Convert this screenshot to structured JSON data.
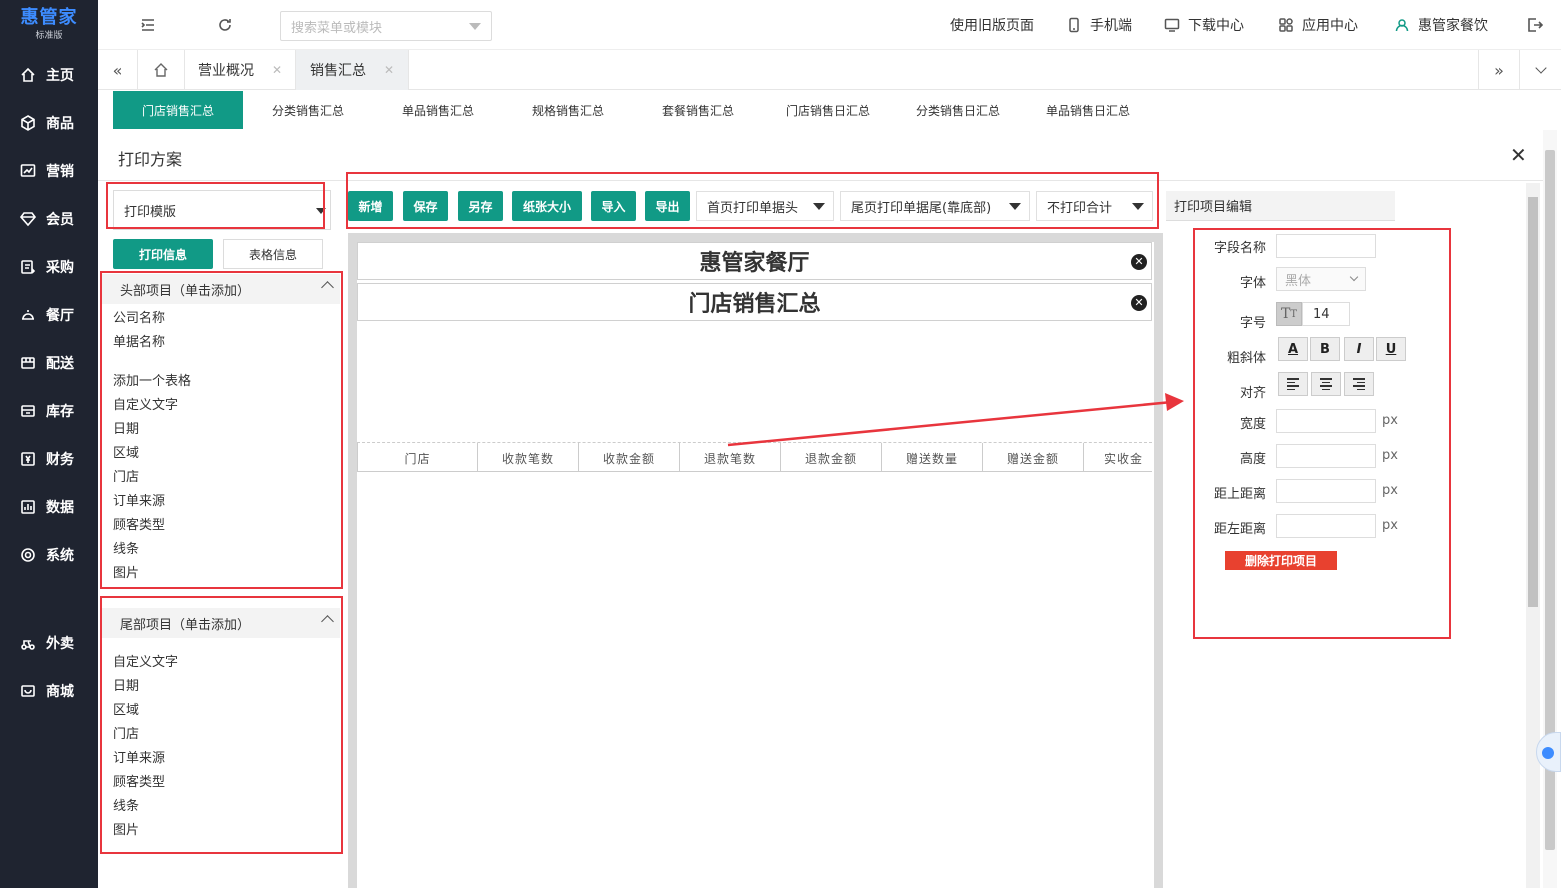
{
  "app": {
    "brand": "惠管家",
    "edition": "标准版"
  },
  "sidebar": {
    "items": [
      {
        "label": "主页",
        "icon": "home-icon"
      },
      {
        "label": "商品",
        "icon": "box-icon"
      },
      {
        "label": "营销",
        "icon": "chart-icon"
      },
      {
        "label": "会员",
        "icon": "diamond-icon"
      },
      {
        "label": "采购",
        "icon": "purchase-icon"
      },
      {
        "label": "餐厅",
        "icon": "restaurant-icon"
      },
      {
        "label": "配送",
        "icon": "delivery-icon"
      },
      {
        "label": "库存",
        "icon": "inventory-icon"
      },
      {
        "label": "财务",
        "icon": "finance-icon"
      },
      {
        "label": "数据",
        "icon": "data-icon"
      },
      {
        "label": "系统",
        "icon": "settings-icon"
      },
      {
        "label": "外卖",
        "icon": "takeout-icon"
      },
      {
        "label": "商城",
        "icon": "mall-icon"
      }
    ]
  },
  "topbar": {
    "search_placeholder": "搜索菜单或模块",
    "old_version": "使用旧版页面",
    "mobile": "手机端",
    "download": "下载中心",
    "apps": "应用中心",
    "user": "惠管家餐饮"
  },
  "tabs": [
    {
      "label": "营业概况"
    },
    {
      "label": "销售汇总"
    }
  ],
  "subtabs": [
    "门店销售汇总",
    "分类销售汇总",
    "单品销售汇总",
    "规格销售汇总",
    "套餐销售汇总",
    "门店销售日汇总",
    "分类销售日汇总",
    "单品销售日汇总"
  ],
  "panel": {
    "title": "打印方案",
    "template_select": "打印模版",
    "tab_print_info": "打印信息",
    "tab_table_info": "表格信息",
    "header_section": "头部项目（单击添加）",
    "header_items_a": [
      "公司名称",
      "单据名称"
    ],
    "header_items_b": [
      "添加一个表格",
      "自定义文字",
      "日期",
      "区域",
      "门店",
      "订单来源",
      "顾客类型",
      "线条",
      "图片"
    ],
    "footer_section": "尾部项目（单击添加）",
    "footer_items": [
      "自定义文字",
      "日期",
      "区域",
      "门店",
      "订单来源",
      "顾客类型",
      "线条",
      "图片"
    ]
  },
  "toolbar": {
    "new": "新增",
    "save": "保存",
    "save_as": "另存",
    "paper_size": "纸张大小",
    "import": "导入",
    "export": "导出",
    "first_page_header": "首页打印单据头",
    "last_page_footer": "尾页打印单据尾(靠底部)",
    "no_total": "不打印合计"
  },
  "canvas": {
    "company": "惠管家餐厅",
    "doc_title": "门店销售汇总",
    "columns": [
      "门店",
      "收款笔数",
      "收款金额",
      "退款笔数",
      "退款金额",
      "赠送数量",
      "赠送金额",
      "实收金"
    ]
  },
  "editor": {
    "title": "打印项目编辑",
    "field_name": "字段名称",
    "font": "字体",
    "font_value": "黑体",
    "size": "字号",
    "size_value": "14",
    "bold_italic": "粗斜体",
    "align": "对齐",
    "width": "宽度",
    "height": "高度",
    "top": "距上距离",
    "left": "距左距离",
    "unit": "px",
    "style_buttons": [
      "A",
      "B",
      "I",
      "U"
    ],
    "delete": "删除打印项目"
  },
  "colors": {
    "accent": "#119a86",
    "sidebar": "#1f2430",
    "highlight": "#e8353d",
    "danger": "#e8412f"
  }
}
